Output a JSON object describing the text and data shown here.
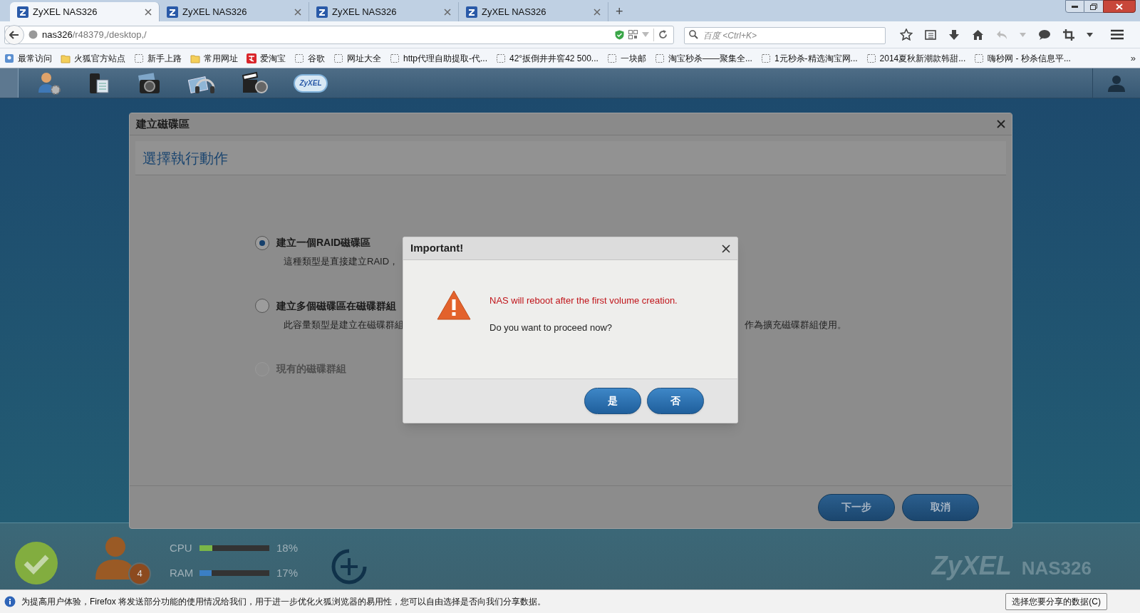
{
  "browser": {
    "tabs": [
      {
        "label": "ZyXEL NAS326",
        "selected": true
      },
      {
        "label": "ZyXEL NAS326",
        "selected": false
      },
      {
        "label": "ZyXEL NAS326",
        "selected": false
      },
      {
        "label": "ZyXEL NAS326",
        "selected": false
      }
    ],
    "new_tab": "+",
    "address": {
      "host": "nas326",
      "path": "/r48379,/desktop,/"
    },
    "search": {
      "placeholder": "百度 <Ctrl+K>"
    },
    "bookmarks": [
      {
        "label": "最常访问",
        "kind": "history"
      },
      {
        "label": "火狐官方站点",
        "kind": "folder"
      },
      {
        "label": "新手上路",
        "kind": "page"
      },
      {
        "label": "常用网址",
        "kind": "folder"
      },
      {
        "label": "爱淘宝",
        "kind": "taobao"
      },
      {
        "label": "谷歌",
        "kind": "page"
      },
      {
        "label": "网址大全",
        "kind": "page"
      },
      {
        "label": "http代理自助提取-代...",
        "kind": "page"
      },
      {
        "label": "42°扳倒井井窖42 500...",
        "kind": "page"
      },
      {
        "label": "一块邮",
        "kind": "page"
      },
      {
        "label": "淘宝秒杀——聚集全...",
        "kind": "page"
      },
      {
        "label": "1元秒杀-精选淘宝网...",
        "kind": "page"
      },
      {
        "label": "2014夏秋新潮款韩甜...",
        "kind": "page"
      },
      {
        "label": "嗨秒网 - 秒杀信息平...",
        "kind": "page"
      }
    ],
    "bookmarks_overflow": "»"
  },
  "nas": {
    "cloud_logo": "ZyXEL",
    "status": {
      "users_badge": "4",
      "meters": [
        {
          "label": "CPU",
          "level": 0.18,
          "reading": "18%",
          "color": "#7ab648"
        },
        {
          "label": "RAM",
          "level": 0.17,
          "reading": "17%",
          "color": "#3b7fc4"
        }
      ]
    },
    "brand": {
      "name": "ZyXEL",
      "model": "NAS326"
    }
  },
  "wizard": {
    "title": "建立磁碟區",
    "heading": "選擇執行動作",
    "options": [
      {
        "title": "建立一個RAID磁碟區",
        "description": "這種類型是直接建立RAID，",
        "selected": true,
        "disabled": false
      },
      {
        "title": "建立多個磁碟區在磁碟群組",
        "description": "此容量類型是建立在磁碟群組",
        "description_end": "作為擴充磁碟群組使用。",
        "selected": false,
        "disabled": false
      },
      {
        "title": "現有的磁碟群組",
        "selected": false,
        "disabled": true
      }
    ],
    "buttons": [
      "下一步",
      "取消"
    ]
  },
  "dialog": {
    "title": "Important!",
    "warning": "NAS will reboot after the first volume creation.",
    "question": "Do you want to proceed now?",
    "buttons": [
      "是",
      "否"
    ]
  },
  "notification": {
    "text": "为提高用户体验，Firefox 将发送部分功能的使用情况给我们，用于进一步优化火狐浏览器的易用性，您可以自由选择是否向我们分享数据。",
    "button": "选择您要分享的数据(C)"
  }
}
